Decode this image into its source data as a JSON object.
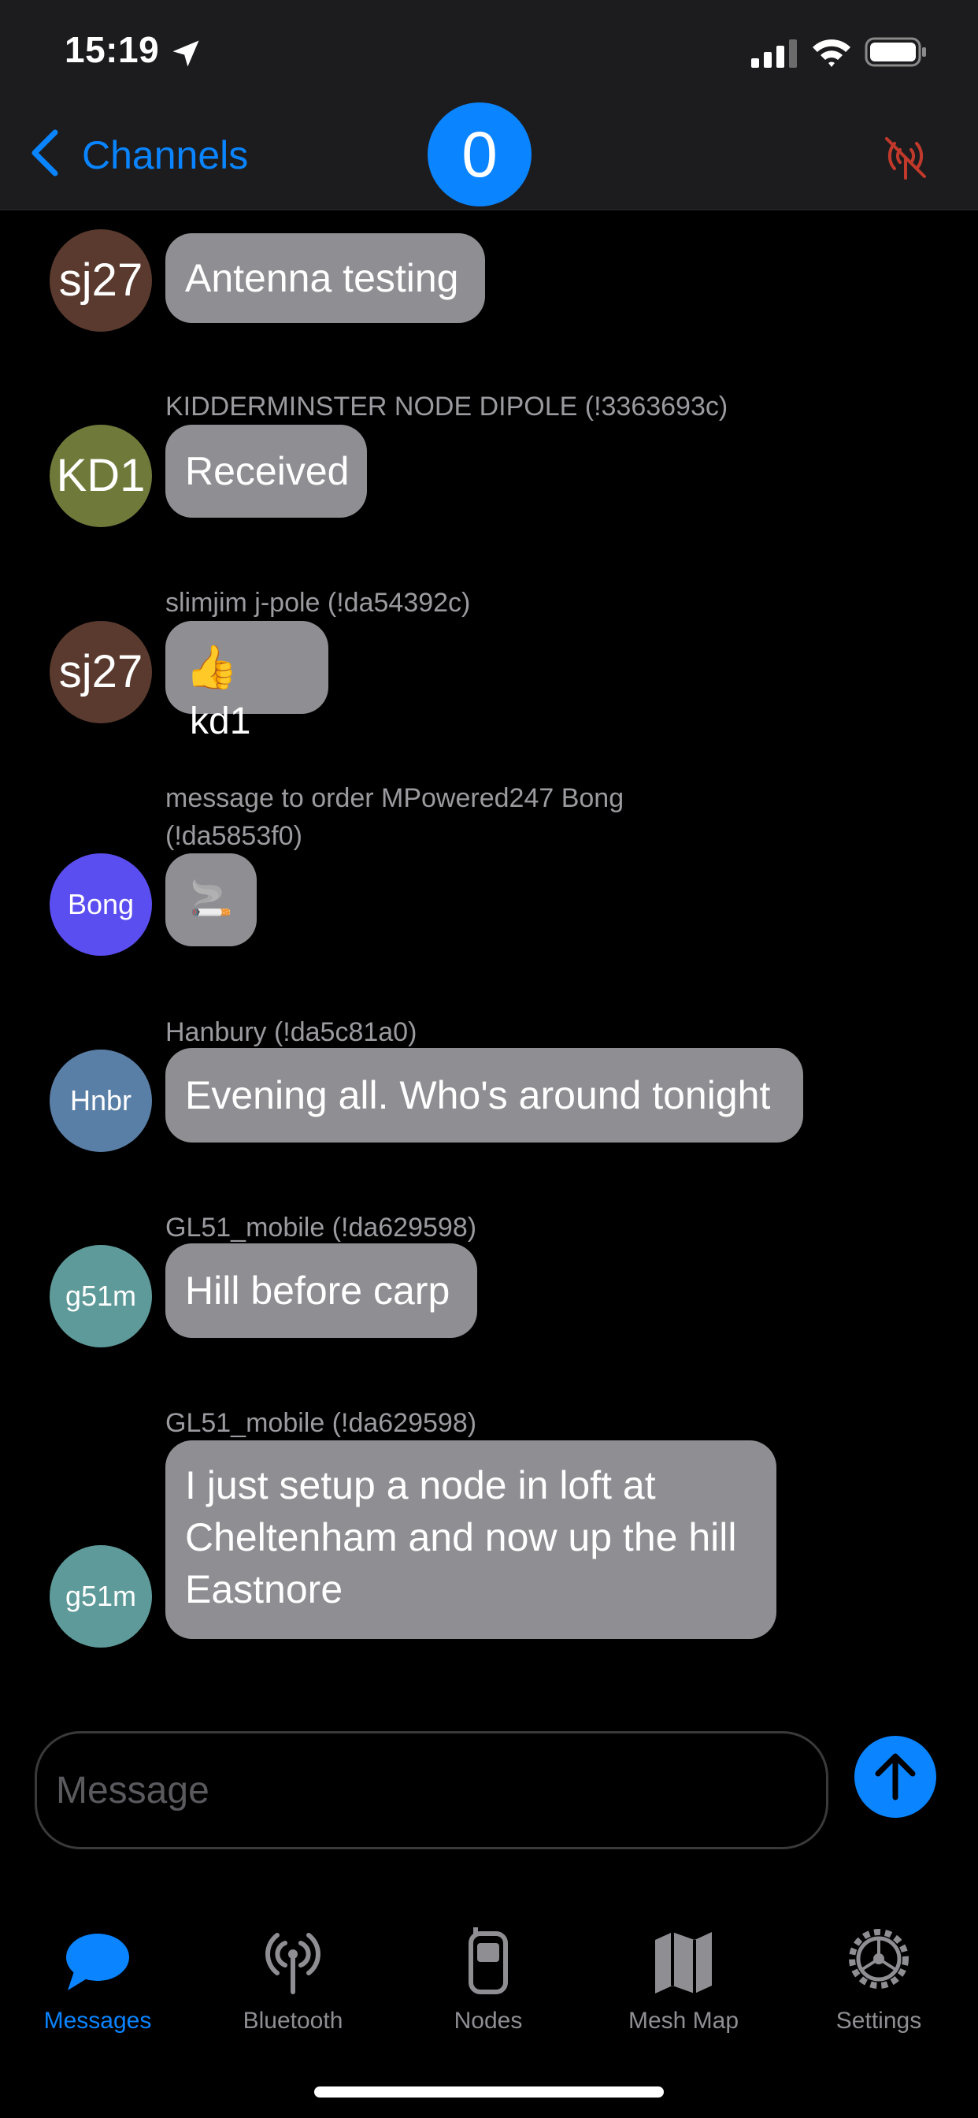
{
  "status_bar": {
    "time": "15:19"
  },
  "nav": {
    "back_label": "Channels",
    "channel_index": "0"
  },
  "messages": [
    {
      "avatar": "sj27",
      "avatar_color": "#5a3a2e",
      "sender": "",
      "text": "Antenna testing"
    },
    {
      "avatar": "KD1",
      "avatar_color": "#6f7a3a",
      "sender": "KIDDERMINSTER NODE DIPOLE (!3363693c)",
      "text": "Received"
    },
    {
      "avatar": "sj27",
      "avatar_color": "#5a3a2e",
      "sender": "slimjim j-pole (!da54392c)",
      "emoji": "👍",
      "text": "kd1"
    },
    {
      "avatar": "Bong",
      "avatar_color": "#5b4ef0",
      "sender_line1": "message to order MPowered247 Bong",
      "sender_line2": "(!da5853f0)",
      "emoji": "🚬"
    },
    {
      "avatar": "Hnbr",
      "avatar_color": "#5a7fa6",
      "sender": "Hanbury (!da5c81a0)",
      "text": "Evening all. Who's around tonight"
    },
    {
      "avatar": "g51m",
      "avatar_color": "#5e9a9a",
      "sender": "GL51_mobile (!da629598)",
      "text": "Hill before carp"
    },
    {
      "avatar": "g51m",
      "avatar_color": "#5e9a9a",
      "sender": "GL51_mobile (!da629598)",
      "lines": [
        "I just setup a node in loft at",
        "Cheltenham and now up the hill",
        "Eastnore"
      ]
    }
  ],
  "composer": {
    "placeholder": "Message"
  },
  "tabs": [
    {
      "label": "Messages",
      "icon": "chat-bubble-icon",
      "active": true
    },
    {
      "label": "Bluetooth",
      "icon": "antenna-icon",
      "active": false
    },
    {
      "label": "Nodes",
      "icon": "device-icon",
      "active": false
    },
    {
      "label": "Mesh Map",
      "icon": "map-icon",
      "active": false
    },
    {
      "label": "Settings",
      "icon": "gear-icon",
      "active": false
    }
  ],
  "colors": {
    "accent": "#0a84ff",
    "disconnected": "#c0392b",
    "bubble": "#8e8e93"
  }
}
